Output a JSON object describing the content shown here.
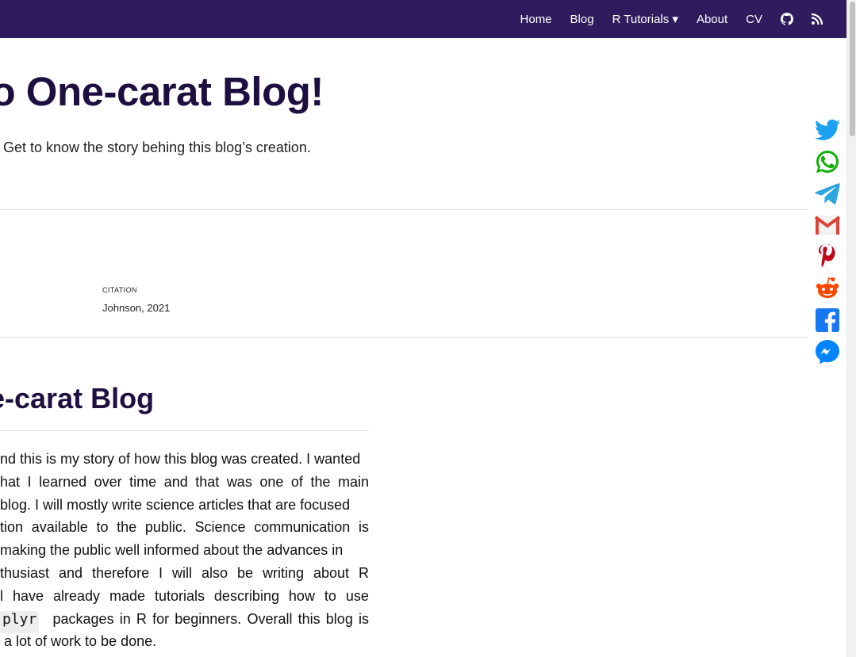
{
  "navbar": {
    "items": [
      {
        "label": "Home"
      },
      {
        "label": "Blog"
      },
      {
        "label": "R Tutorials ▾"
      },
      {
        "label": "About"
      },
      {
        "label": "CV"
      }
    ],
    "icons": [
      "github-icon",
      "rss-icon"
    ],
    "background": "#2f1c5e"
  },
  "header": {
    "title": "to One-carat Blog!",
    "subtitle": "Get to know the story behing this blog’s creation."
  },
  "citation": {
    "label": "CITATION",
    "value": "Johnson, 2021"
  },
  "section": {
    "title": "e-carat Blog"
  },
  "body": {
    "lines": [
      [
        "nd this is my story of how this blog was created. I wanted"
      ],
      [
        "hat",
        "I",
        "learned",
        "over",
        "time",
        "and",
        "that",
        "was",
        "one",
        "of",
        "the",
        "main"
      ],
      [
        "blog. I will mostly write science articles that are focused"
      ],
      [
        "tion",
        "available",
        "to",
        "the",
        "public.",
        "Science",
        "communication",
        "is"
      ],
      [
        "making the public well informed about the advances in"
      ],
      [
        "thusiast",
        "and",
        "therefore",
        "I",
        "will",
        "also",
        "be",
        "writing",
        "about",
        "R"
      ],
      [
        "l",
        "have",
        "already",
        "made",
        "tutorials",
        "describing",
        "how",
        "to",
        "use"
      ]
    ],
    "code_text": "plyr",
    "code_line_rest": [
      "packages",
      "in",
      "R",
      "for",
      "beginners.",
      "Overall",
      "this",
      "blog",
      "is"
    ],
    "last_line": "a lot of work to be done."
  },
  "share": {
    "buttons": [
      {
        "name": "twitter-icon",
        "color": "#1da1f2"
      },
      {
        "name": "whatsapp-icon",
        "color": "#12af0a"
      },
      {
        "name": "telegram-icon",
        "color": "#2ca5e0"
      },
      {
        "name": "gmail-icon",
        "color": "#db4437"
      },
      {
        "name": "pinterest-icon",
        "color": "#bd081c"
      },
      {
        "name": "reddit-icon",
        "color": "#ff4500"
      },
      {
        "name": "facebook-icon",
        "color": "#1877f2"
      },
      {
        "name": "messenger-icon",
        "color": "#0084ff"
      }
    ]
  }
}
